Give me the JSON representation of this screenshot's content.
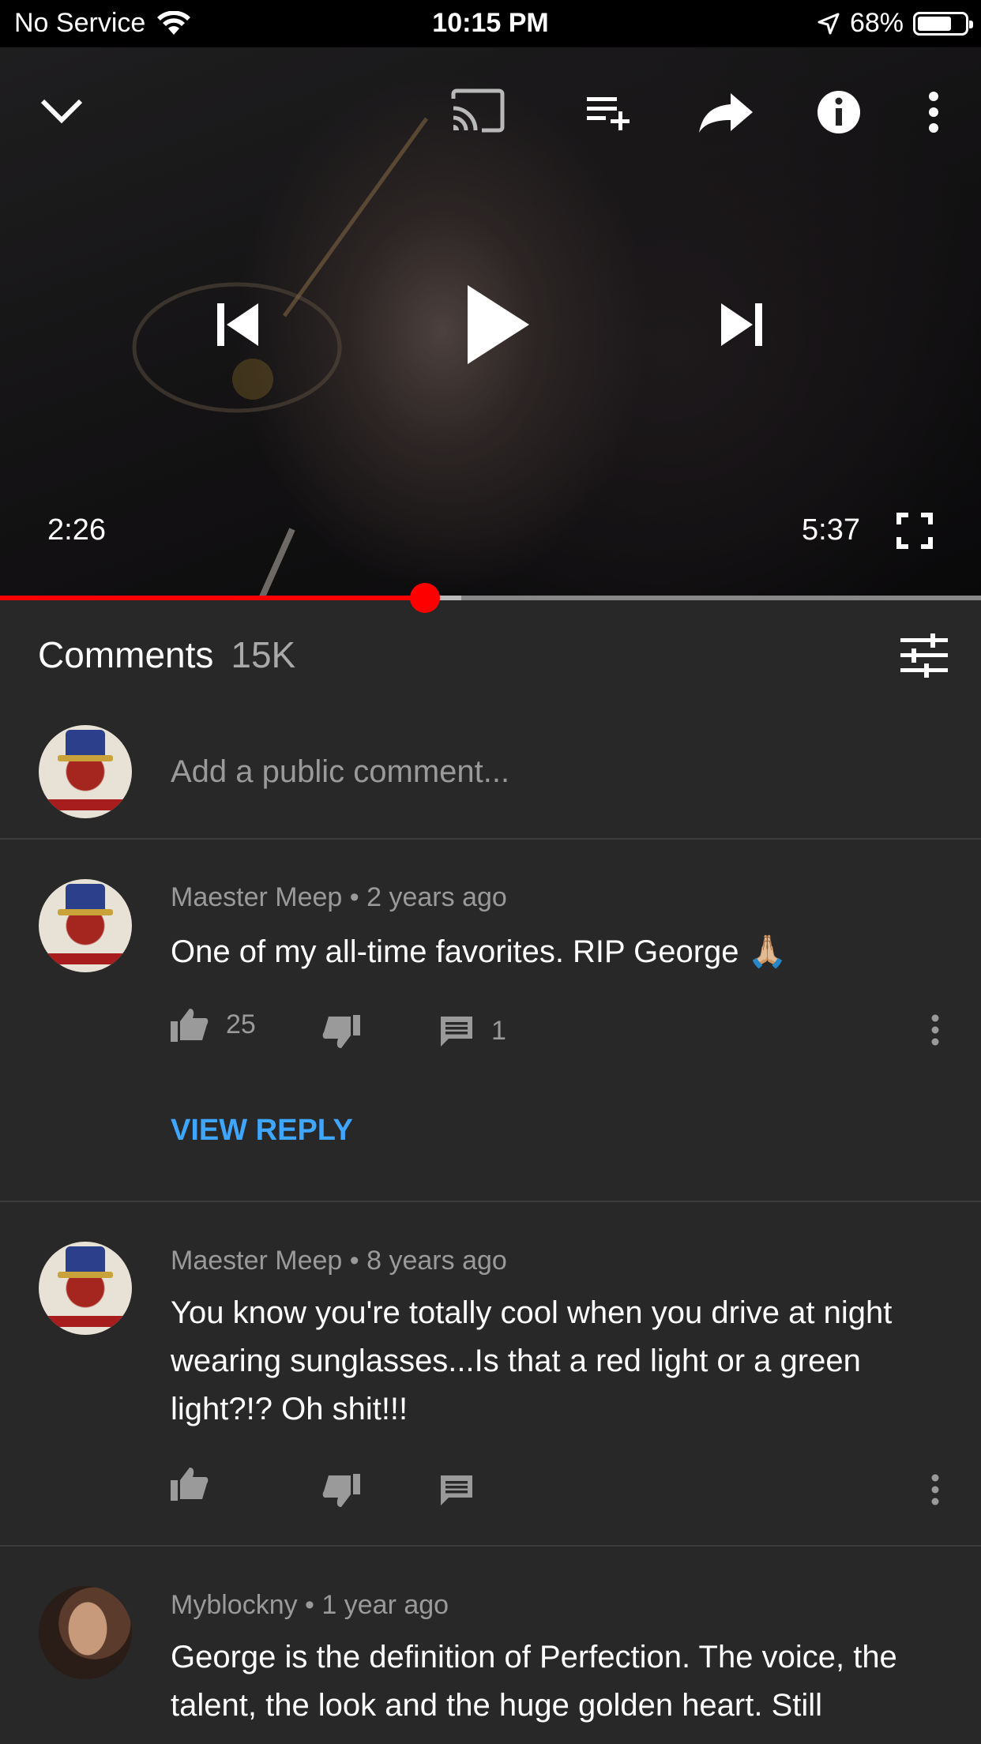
{
  "status_bar": {
    "carrier": "No Service",
    "time": "10:15 PM",
    "battery": "68%",
    "battery_level": 0.68
  },
  "player": {
    "current_time": "2:26",
    "duration": "5:37",
    "progress_fraction": 0.433,
    "buffered_fraction": 0.47,
    "icons": [
      "chevron-down-icon",
      "cast-icon",
      "add-to-queue-icon",
      "share-icon",
      "info-icon",
      "more-vert-icon",
      "previous-icon",
      "play-icon",
      "next-icon",
      "fullscreen-icon"
    ]
  },
  "comments": {
    "title": "Comments",
    "count": "15K",
    "add_placeholder": "Add a public comment...",
    "items": [
      {
        "author": "Maester Meep",
        "age": "2 years ago",
        "text": "One of my all-time favorites. RIP George 🙏🏼",
        "likes": "25",
        "replies": "1",
        "view_reply": "VIEW REPLY"
      },
      {
        "author": "Maester Meep",
        "age": "8 years ago",
        "text": "You know you're totally cool when you drive at night wearing sunglasses...Is that a red light or a green light?!?  Oh shit!!!",
        "likes": "",
        "replies": ""
      },
      {
        "author": "Myblockny",
        "age": "1 year ago",
        "text": "George is the definition of Perfection. The voice, the talent, the look and the huge golden heart. Still"
      }
    ]
  },
  "colors": {
    "accent_red": "#ff0000",
    "link_blue": "#3ea6ff",
    "background": "#282828"
  }
}
